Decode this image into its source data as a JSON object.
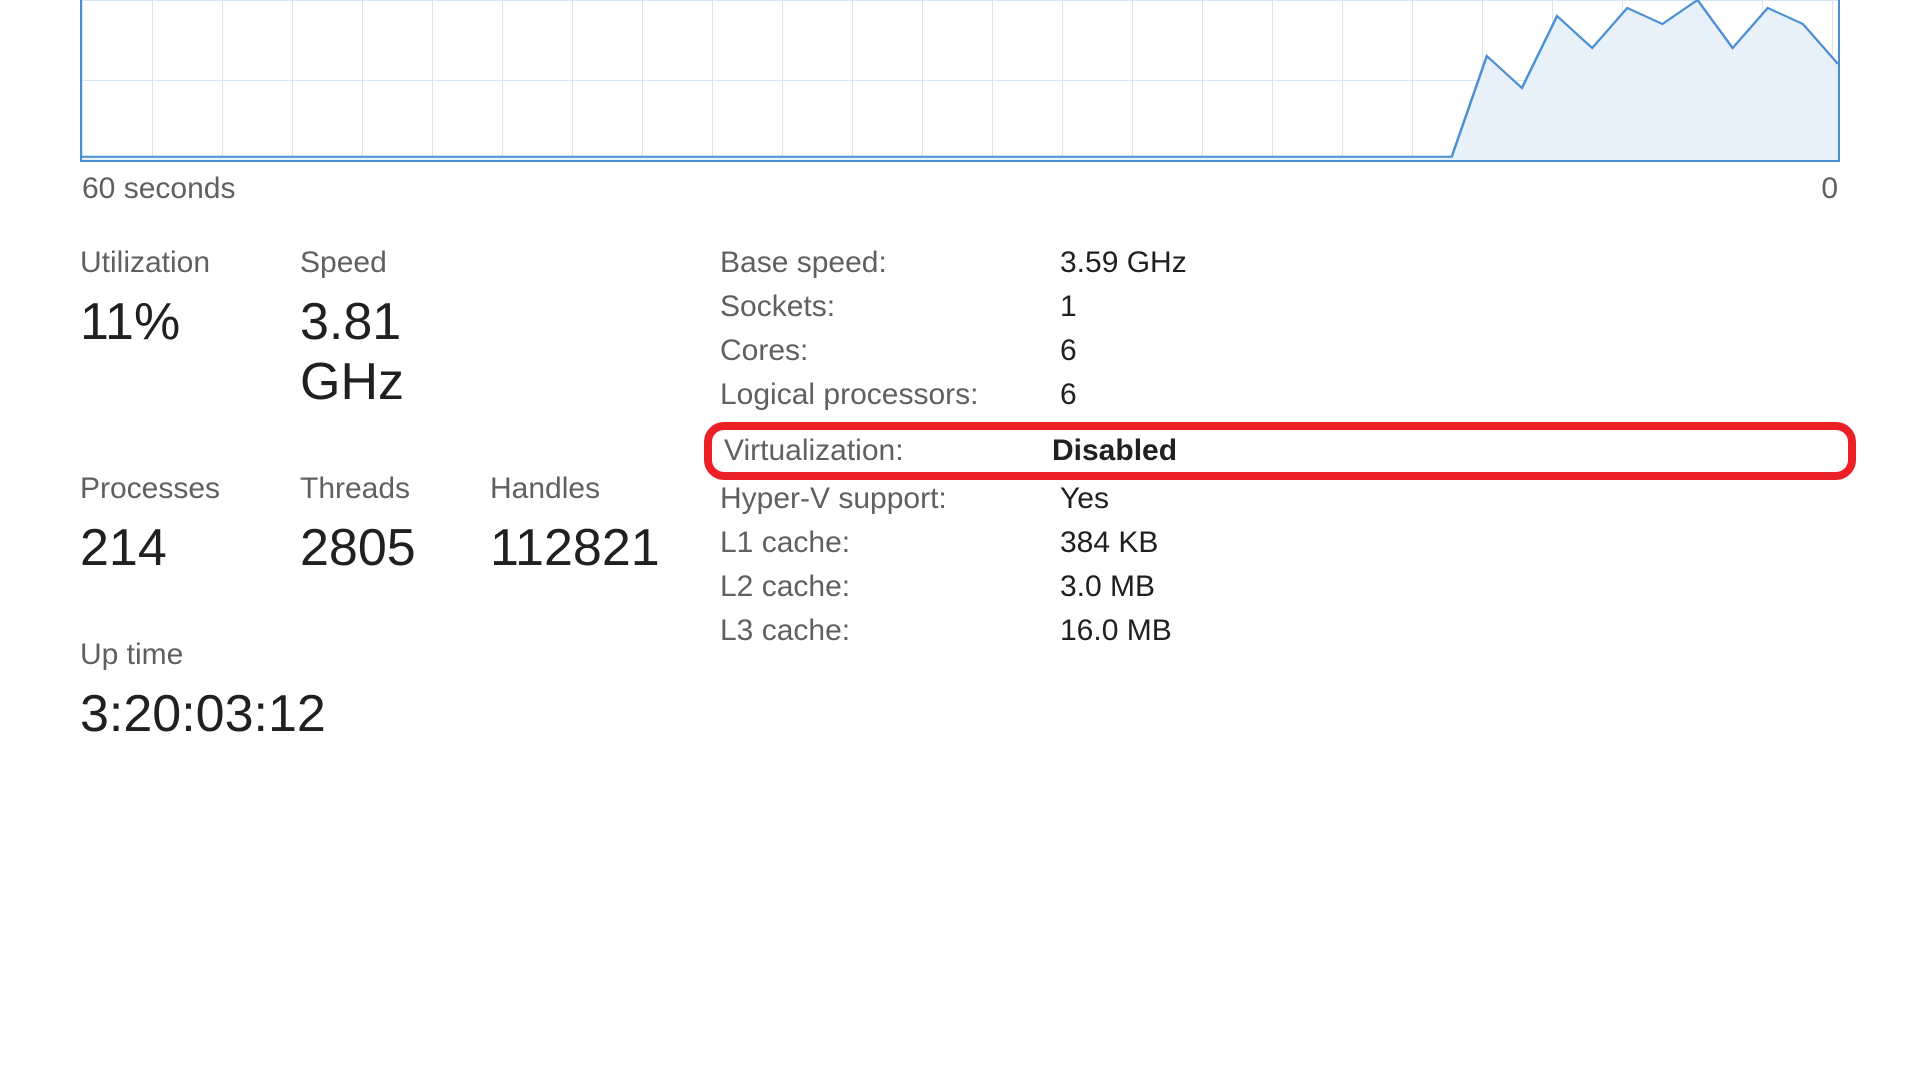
{
  "chart_data": {
    "type": "line",
    "x_axis_left": "60 seconds",
    "x_axis_right": "0",
    "ylim": [
      0,
      100
    ],
    "x_range": [
      0,
      100
    ],
    "points": [
      {
        "x": 0,
        "y": 2
      },
      {
        "x": 5,
        "y": 2
      },
      {
        "x": 10,
        "y": 2
      },
      {
        "x": 15,
        "y": 2
      },
      {
        "x": 20,
        "y": 2
      },
      {
        "x": 25,
        "y": 2
      },
      {
        "x": 30,
        "y": 2
      },
      {
        "x": 35,
        "y": 2
      },
      {
        "x": 40,
        "y": 2
      },
      {
        "x": 45,
        "y": 2
      },
      {
        "x": 50,
        "y": 2
      },
      {
        "x": 55,
        "y": 2
      },
      {
        "x": 60,
        "y": 2
      },
      {
        "x": 65,
        "y": 2
      },
      {
        "x": 70,
        "y": 2
      },
      {
        "x": 75,
        "y": 2
      },
      {
        "x": 78,
        "y": 2
      },
      {
        "x": 80,
        "y": 65
      },
      {
        "x": 82,
        "y": 45
      },
      {
        "x": 84,
        "y": 90
      },
      {
        "x": 86,
        "y": 70
      },
      {
        "x": 88,
        "y": 95
      },
      {
        "x": 90,
        "y": 85
      },
      {
        "x": 92,
        "y": 100
      },
      {
        "x": 94,
        "y": 70
      },
      {
        "x": 96,
        "y": 95
      },
      {
        "x": 98,
        "y": 85
      },
      {
        "x": 100,
        "y": 60
      }
    ]
  },
  "stats": {
    "utilization": {
      "label": "Utilization",
      "value": "11%"
    },
    "speed": {
      "label": "Speed",
      "value": "3.81 GHz"
    },
    "processes": {
      "label": "Processes",
      "value": "214"
    },
    "threads": {
      "label": "Threads",
      "value": "2805"
    },
    "handles": {
      "label": "Handles",
      "value": "112821"
    },
    "uptime": {
      "label": "Up time",
      "value": "3:20:03:12"
    }
  },
  "specs": {
    "base_speed": {
      "label": "Base speed:",
      "value": "3.59 GHz"
    },
    "sockets": {
      "label": "Sockets:",
      "value": "1"
    },
    "cores": {
      "label": "Cores:",
      "value": "6"
    },
    "logical_processors": {
      "label": "Logical processors:",
      "value": "6"
    },
    "virtualization": {
      "label": "Virtualization:",
      "value": "Disabled"
    },
    "hyperv": {
      "label": "Hyper-V support:",
      "value": "Yes"
    },
    "l1_cache": {
      "label": "L1 cache:",
      "value": "384 KB"
    },
    "l2_cache": {
      "label": "L2 cache:",
      "value": "3.0 MB"
    },
    "l3_cache": {
      "label": "L3 cache:",
      "value": "16.0 MB"
    }
  }
}
